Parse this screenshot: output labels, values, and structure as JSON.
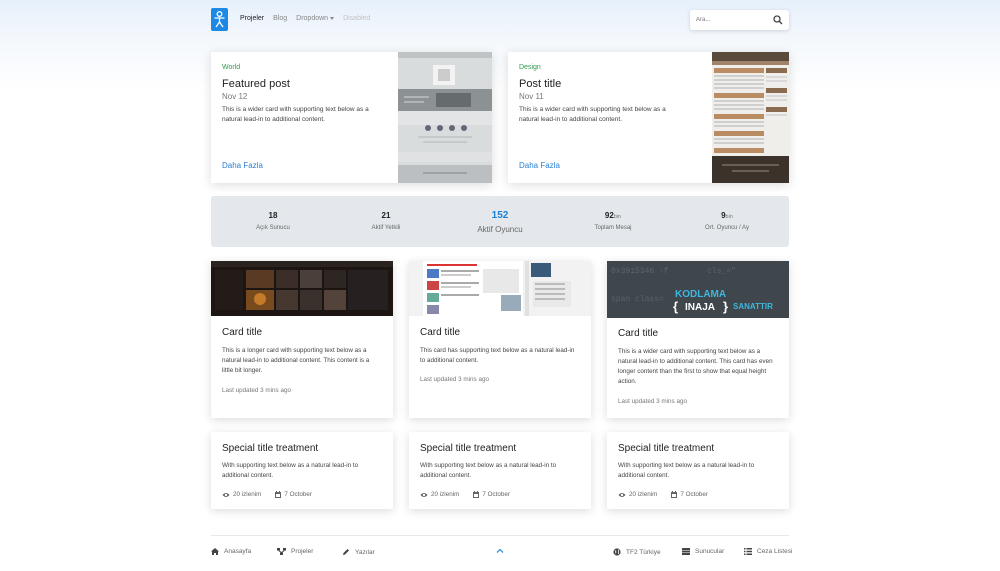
{
  "header": {
    "nav": [
      "Projeler",
      "Blog",
      "Dropdown",
      "Disabled"
    ],
    "search_placeholder": "Ara..."
  },
  "featured": [
    {
      "category": "World",
      "title": "Featured post",
      "date": "Nov 12",
      "text": "This is a wider card with supporting text below as a natural lead-in to additional content.",
      "link": "Daha Fazla"
    },
    {
      "category": "Design",
      "title": "Post title",
      "date": "Nov 11",
      "text": "This is a wider card with supporting text below as a natural lead-in to additional content.",
      "link": "Daha Fazla"
    }
  ],
  "stats": [
    {
      "value": "18",
      "unit": "",
      "label": "Açık Sunucu"
    },
    {
      "value": "21",
      "unit": "",
      "label": "Aktif Yetkili"
    },
    {
      "value": "152",
      "unit": "",
      "label": "Aktif Oyuncu"
    },
    {
      "value": "92",
      "unit": "bin",
      "label": "Toplam Mesaj"
    },
    {
      "value": "9",
      "unit": "bin",
      "label": "Ort. Oyuncu / Ay"
    }
  ],
  "cards": [
    {
      "title": "Card title",
      "text": "This is a longer card with supporting text below as a natural lead-in to additional content. This content is a little bit longer.",
      "updated": "Last updated 3 mins ago"
    },
    {
      "title": "Card title",
      "text": "This card has supporting text below as a natural lead-in to additional content.",
      "updated": "Last updated 3 mins ago"
    },
    {
      "title": "Card title",
      "text": "This is a wider card with supporting text below as a natural lead-in to additional content. This card has even longer content than the first to show that equal height action.",
      "updated": "Last updated 3 mins ago",
      "image_text_1": "KODLAMA",
      "image_text_2": "INAJA",
      "image_text_3": "SANATTIR"
    }
  ],
  "special": [
    {
      "title": "Special title treatment",
      "text": "With supporting text below as a natural lead-in to additional content.",
      "views": "20 izlenim",
      "date": "7 October"
    },
    {
      "title": "Special title treatment",
      "text": "With supporting text below as a natural lead-in to additional content.",
      "views": "20 izlenim",
      "date": "7 October"
    },
    {
      "title": "Special title treatment",
      "text": "With supporting text below as a natural lead-in to additional content.",
      "views": "20 izlenim",
      "date": "7 October"
    }
  ],
  "footer": {
    "left": [
      "Anasayfa",
      "Projeler",
      "Yazılar"
    ],
    "right": [
      "TF2 Türkiye",
      "Sunucular",
      "Ceza Listesi"
    ]
  },
  "colors": {
    "accent": "#1e88e5",
    "category": "#2e9a4c",
    "link": "#2a7fd4"
  }
}
